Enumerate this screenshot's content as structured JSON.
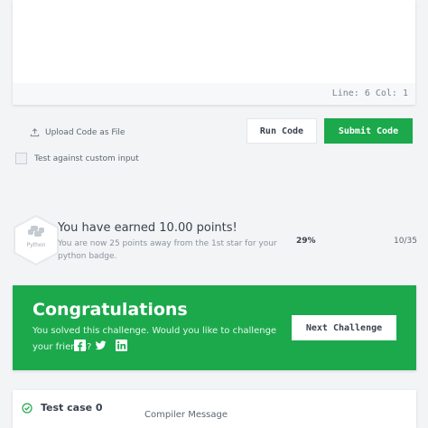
{
  "editor": {
    "status": "Line: 6  Col: 1"
  },
  "actions": {
    "upload_label": "Upload Code as File",
    "custom_input_label": "Test against custom input",
    "run_label": "Run Code",
    "submit_label": "Submit Code"
  },
  "points": {
    "badge_label": "Python",
    "title": "You have earned 10.00 points!",
    "subtitle": "You are now 25 points away from the 1st star for your python badge.",
    "percent": "29%",
    "progress": "10/35"
  },
  "congrats": {
    "title": "Congratulations",
    "message": "You solved this challenge. Would you like to challenge your friends?",
    "next_label": "Next Challenge",
    "social_icons": [
      "facebook-icon",
      "twitter-icon",
      "linkedin-icon"
    ]
  },
  "results": {
    "test_case_label": "Test case 0",
    "compiler_label": "Compiler Message"
  },
  "colors": {
    "accent": "#1ba94c",
    "text": "#39424e",
    "background": "#f3f4f6"
  }
}
